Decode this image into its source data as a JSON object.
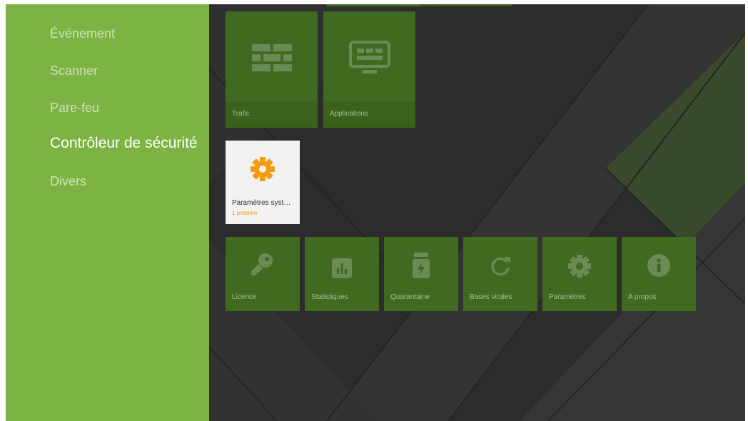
{
  "sidebar": {
    "items": [
      {
        "label": "Événement"
      },
      {
        "label": "Scanner"
      },
      {
        "label": "Pare-feu"
      },
      {
        "label": "Contrôleur de sécurité"
      },
      {
        "label": "Divers"
      }
    ]
  },
  "top_tiles": [
    {
      "label": "Trafic",
      "icon": "brick-wall-icon"
    },
    {
      "label": "Applications",
      "icon": "monitor-icon"
    }
  ],
  "security_tile": {
    "title": "Paramètres syst…",
    "status": "1 problem",
    "icon": "gear-icon",
    "status_color": "#f39c12"
  },
  "bottom_tiles": [
    {
      "label": "Licence",
      "icon": "key-icon"
    },
    {
      "label": "Statistiques",
      "icon": "bar-chart-icon"
    },
    {
      "label": "Quarantaine",
      "icon": "quarantine-jar-icon"
    },
    {
      "label": "Bases virales",
      "icon": "refresh-icon"
    },
    {
      "label": "Paramètres",
      "icon": "gear-icon"
    },
    {
      "label": "A propos",
      "icon": "info-icon"
    }
  ],
  "colors": {
    "sidebar": "#7cb342",
    "tile": "#3f6a1f",
    "background": "#2e2e2e",
    "accent_orange": "#f39c12"
  }
}
